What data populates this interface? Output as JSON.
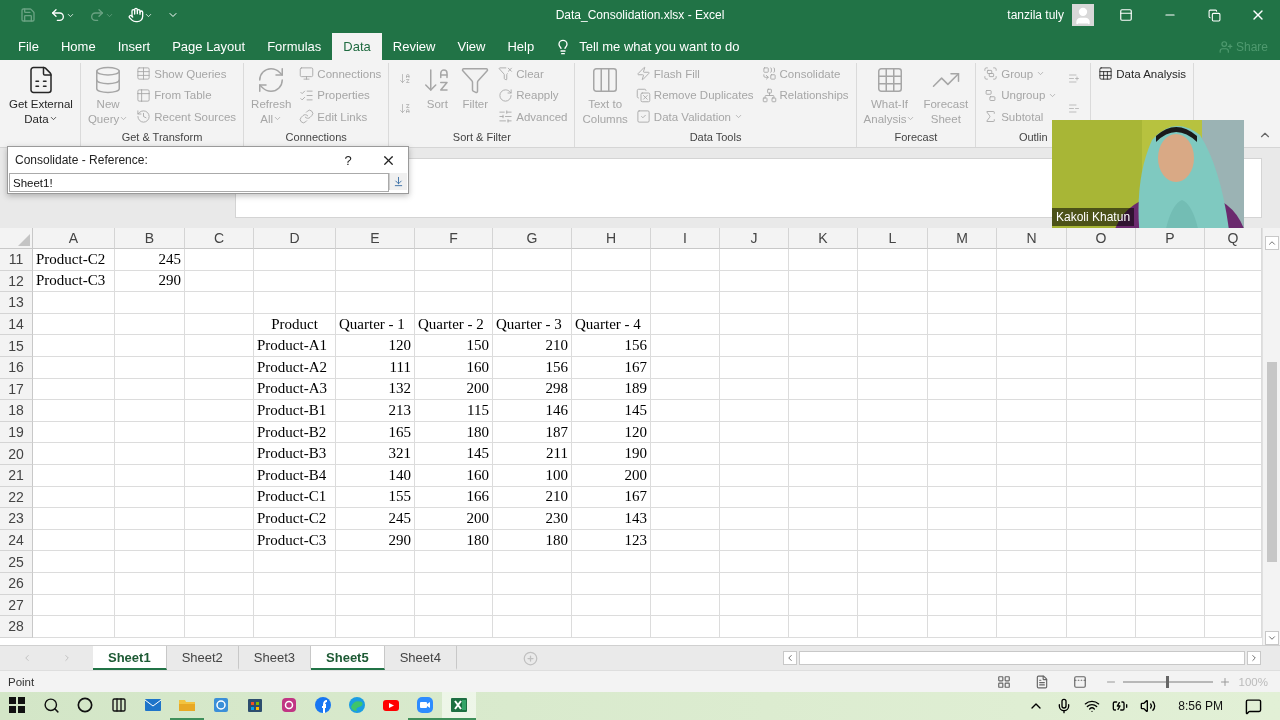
{
  "title_bar": {
    "title": "Data_Consolidation.xlsx  -  Excel",
    "user": "tanzila tuly"
  },
  "menu_tabs": [
    {
      "label": "File",
      "selected": false
    },
    {
      "label": "Home",
      "selected": false
    },
    {
      "label": "Insert",
      "selected": false
    },
    {
      "label": "Page Layout",
      "selected": false
    },
    {
      "label": "Formulas",
      "selected": false
    },
    {
      "label": "Data",
      "selected": true
    },
    {
      "label": "Review",
      "selected": false
    },
    {
      "label": "View",
      "selected": false
    },
    {
      "label": "Help",
      "selected": false
    }
  ],
  "tell_me": "Tell me what you want to do",
  "share": {
    "label": "Share",
    "disabled": true
  },
  "ribbon": {
    "groups": [
      {
        "columns": [
          [
            {
              "kind": "large",
              "label": "Get External\nData",
              "dropdown": true,
              "disabled": false
            }
          ]
        ]
      },
      {
        "label": "Get & Transform",
        "columns": [
          [
            {
              "kind": "large",
              "label": "New\nQuery",
              "dropdown": true,
              "disabled": true
            }
          ],
          [
            {
              "kind": "small",
              "label": "Show Queries",
              "disabled": true
            },
            {
              "kind": "small",
              "label": "From Table",
              "disabled": true
            },
            {
              "kind": "small",
              "label": "Recent Sources",
              "disabled": true
            }
          ]
        ]
      },
      {
        "label": "Connections",
        "columns": [
          [
            {
              "kind": "large",
              "label": "Refresh\nAll",
              "dropdown": true,
              "disabled": true
            }
          ],
          [
            {
              "kind": "small",
              "label": "Connections",
              "disabled": true
            },
            {
              "kind": "small",
              "label": "Properties",
              "disabled": true
            },
            {
              "kind": "small",
              "label": "Edit Links",
              "disabled": true
            }
          ]
        ]
      },
      {
        "label": "Sort & Filter",
        "columns": [
          [
            {
              "kind": "icon",
              "disabled": true
            },
            {
              "kind": "icon",
              "disabled": true
            }
          ],
          [
            {
              "kind": "large",
              "label": "Sort",
              "disabled": true
            }
          ],
          [
            {
              "kind": "large",
              "label": "Filter",
              "disabled": true
            }
          ],
          [
            {
              "kind": "small",
              "label": "Clear",
              "disabled": true
            },
            {
              "kind": "small",
              "label": "Reapply",
              "disabled": true
            },
            {
              "kind": "small",
              "label": "Advanced",
              "disabled": true
            }
          ]
        ]
      },
      {
        "label": "Data Tools",
        "columns": [
          [
            {
              "kind": "large",
              "label": "Text to\nColumns",
              "disabled": true
            }
          ],
          [
            {
              "kind": "small",
              "label": "Flash Fill",
              "disabled": true
            },
            {
              "kind": "small",
              "label": "Remove Duplicates",
              "disabled": true
            },
            {
              "kind": "small",
              "label": "Data Validation",
              "dropdown": true,
              "disabled": true
            }
          ],
          [
            {
              "kind": "small",
              "label": "Consolidate",
              "disabled": true
            },
            {
              "kind": "small",
              "label": "Relationships",
              "disabled": true
            }
          ]
        ]
      },
      {
        "label": "Forecast",
        "columns": [
          [
            {
              "kind": "large",
              "label": "What-If\nAnalysis",
              "dropdown": true,
              "disabled": true
            }
          ],
          [
            {
              "kind": "large",
              "label": "Forecast\nSheet",
              "disabled": true
            }
          ]
        ]
      },
      {
        "label": "Outlin",
        "columns": [
          [
            {
              "kind": "small",
              "label": "Group",
              "dropdown": true,
              "disabled": true
            },
            {
              "kind": "small",
              "label": "Ungroup",
              "dropdown": true,
              "disabled": true
            },
            {
              "kind": "small",
              "label": "Subtotal",
              "disabled": true
            }
          ],
          [
            {
              "kind": "icon",
              "disabled": true
            },
            {
              "kind": "icon",
              "disabled": true
            }
          ]
        ]
      },
      {
        "columns": [
          [
            {
              "kind": "small",
              "label": "Data Analysis",
              "disabled": false
            }
          ]
        ]
      }
    ]
  },
  "dialog": {
    "title": "Consolidate - Reference:",
    "help": "?",
    "value": "Sheet1!"
  },
  "sheet": {
    "columns": [
      "A",
      "B",
      "C",
      "D",
      "E",
      "F",
      "G",
      "H",
      "I",
      "J",
      "K",
      "L",
      "M",
      "N",
      "O",
      "P",
      "Q"
    ],
    "rows": [
      {
        "number": "11",
        "cells": [
          "Product-C2",
          {
            "text": "245",
            "numeric": true
          }
        ]
      },
      {
        "number": "12",
        "cells": [
          "Product-C3",
          {
            "text": "290",
            "numeric": true
          }
        ]
      },
      {
        "number": "13"
      },
      {
        "number": "14",
        "cells": [
          null,
          null,
          null,
          {
            "text": "Product",
            "centered": true
          },
          "Quarter - 1",
          "Quarter - 2",
          "Quarter - 3",
          "Quarter - 4"
        ]
      },
      {
        "number": "15",
        "cells": [
          null,
          null,
          null,
          "Product-A1",
          {
            "text": "120",
            "numeric": true
          },
          {
            "text": "150",
            "numeric": true
          },
          {
            "text": "210",
            "numeric": true
          },
          {
            "text": "156",
            "numeric": true
          }
        ]
      },
      {
        "number": "16",
        "cells": [
          null,
          null,
          null,
          "Product-A2",
          {
            "text": "111",
            "numeric": true
          },
          {
            "text": "160",
            "numeric": true
          },
          {
            "text": "156",
            "numeric": true
          },
          {
            "text": "167",
            "numeric": true
          }
        ]
      },
      {
        "number": "17",
        "cells": [
          null,
          null,
          null,
          "Product-A3",
          {
            "text": "132",
            "numeric": true
          },
          {
            "text": "200",
            "numeric": true
          },
          {
            "text": "298",
            "numeric": true
          },
          {
            "text": "189",
            "numeric": true
          }
        ]
      },
      {
        "number": "18",
        "cells": [
          null,
          null,
          null,
          "Product-B1",
          {
            "text": "213",
            "numeric": true
          },
          {
            "text": "115",
            "numeric": true
          },
          {
            "text": "146",
            "numeric": true
          },
          {
            "text": "145",
            "numeric": true
          }
        ]
      },
      {
        "number": "19",
        "cells": [
          null,
          null,
          null,
          "Product-B2",
          {
            "text": "165",
            "numeric": true
          },
          {
            "text": "180",
            "numeric": true
          },
          {
            "text": "187",
            "numeric": true
          },
          {
            "text": "120",
            "numeric": true
          }
        ]
      },
      {
        "number": "20",
        "cells": [
          null,
          null,
          null,
          "Product-B3",
          {
            "text": "321",
            "numeric": true
          },
          {
            "text": "145",
            "numeric": true
          },
          {
            "text": "211",
            "numeric": true
          },
          {
            "text": "190",
            "numeric": true
          }
        ]
      },
      {
        "number": "21",
        "cells": [
          null,
          null,
          null,
          "Product-B4",
          {
            "text": "140",
            "numeric": true
          },
          {
            "text": "160",
            "numeric": true
          },
          {
            "text": "100",
            "numeric": true
          },
          {
            "text": "200",
            "numeric": true
          }
        ]
      },
      {
        "number": "22",
        "cells": [
          null,
          null,
          null,
          "Product-C1",
          {
            "text": "155",
            "numeric": true
          },
          {
            "text": "166",
            "numeric": true
          },
          {
            "text": "210",
            "numeric": true
          },
          {
            "text": "167",
            "numeric": true
          }
        ]
      },
      {
        "number": "23",
        "cells": [
          null,
          null,
          null,
          "Product-C2",
          {
            "text": "245",
            "numeric": true
          },
          {
            "text": "200",
            "numeric": true
          },
          {
            "text": "230",
            "numeric": true
          },
          {
            "text": "143",
            "numeric": true
          }
        ]
      },
      {
        "number": "24",
        "cells": [
          null,
          null,
          null,
          "Product-C3",
          {
            "text": "290",
            "numeric": true
          },
          {
            "text": "180",
            "numeric": true
          },
          {
            "text": "180",
            "numeric": true
          },
          {
            "text": "123",
            "numeric": true
          }
        ]
      },
      {
        "number": "25"
      },
      {
        "number": "26"
      },
      {
        "number": "27"
      },
      {
        "number": "28"
      }
    ]
  },
  "webcam": {
    "name": "Kakoli Khatun"
  },
  "sheet_tabs": [
    {
      "label": "Sheet1",
      "selected": true
    },
    {
      "label": "Sheet2",
      "selected": false
    },
    {
      "label": "Sheet3",
      "selected": false
    },
    {
      "label": "Sheet5",
      "selected": true
    },
    {
      "label": "Sheet4",
      "selected": false
    }
  ],
  "status_bar": {
    "mode": "Point",
    "zoom": {
      "level": 0.5,
      "reading": "100%"
    }
  },
  "taskbar": {
    "apps": [
      {
        "kind": "mail",
        "running": false,
        "selected": false
      },
      {
        "kind": "folder",
        "running": true,
        "selected": false
      },
      {
        "kind": "recycle",
        "running": false,
        "selected": false
      },
      {
        "kind": "store",
        "running": false,
        "selected": false
      },
      {
        "kind": "camera",
        "running": false,
        "selected": false
      },
      {
        "kind": "social",
        "running": false,
        "selected": false
      },
      {
        "kind": "browser",
        "running": false,
        "selected": false
      },
      {
        "kind": "video",
        "running": false,
        "selected": false
      },
      {
        "kind": "meeting",
        "running": true,
        "selected": false
      },
      {
        "kind": "sheet",
        "running": true,
        "selected": true
      }
    ],
    "time": "8:56 PM"
  }
}
